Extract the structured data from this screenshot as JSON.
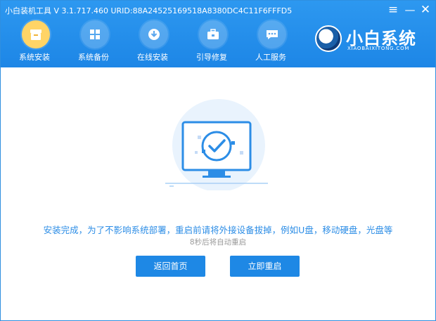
{
  "window": {
    "title": "小白装机工具 V 3.1.717.460 URID:88A24525169518A8380DC4C11F6FFFD5",
    "controls": {
      "menu": "≡",
      "minimize": "—",
      "close": "✕"
    }
  },
  "nav": {
    "items": [
      {
        "label": "系统安装",
        "icon": "box-icon",
        "active": true
      },
      {
        "label": "系统备份",
        "icon": "windows-icon",
        "active": false
      },
      {
        "label": "在线安装",
        "icon": "download-icon",
        "active": false
      },
      {
        "label": "引导修复",
        "icon": "toolbox-icon",
        "active": false
      },
      {
        "label": "人工服务",
        "icon": "chat-icon",
        "active": false
      }
    ]
  },
  "brand": {
    "name": "小白系统",
    "subtitle": "XIAOBAIXITONG.COM"
  },
  "main": {
    "message": "安装完成，为了不影响系统部署，重启前请将外接设备拔掉，例如U盘，移动硬盘，光盘等",
    "countdown": "8秒后将自动重启",
    "buttons": {
      "home": "返回首页",
      "restart": "立即重启"
    }
  },
  "colors": {
    "header": "#1d86e6",
    "accent": "#2c8de6",
    "active_nav": "#ffd466",
    "button": "#1e88e5"
  }
}
